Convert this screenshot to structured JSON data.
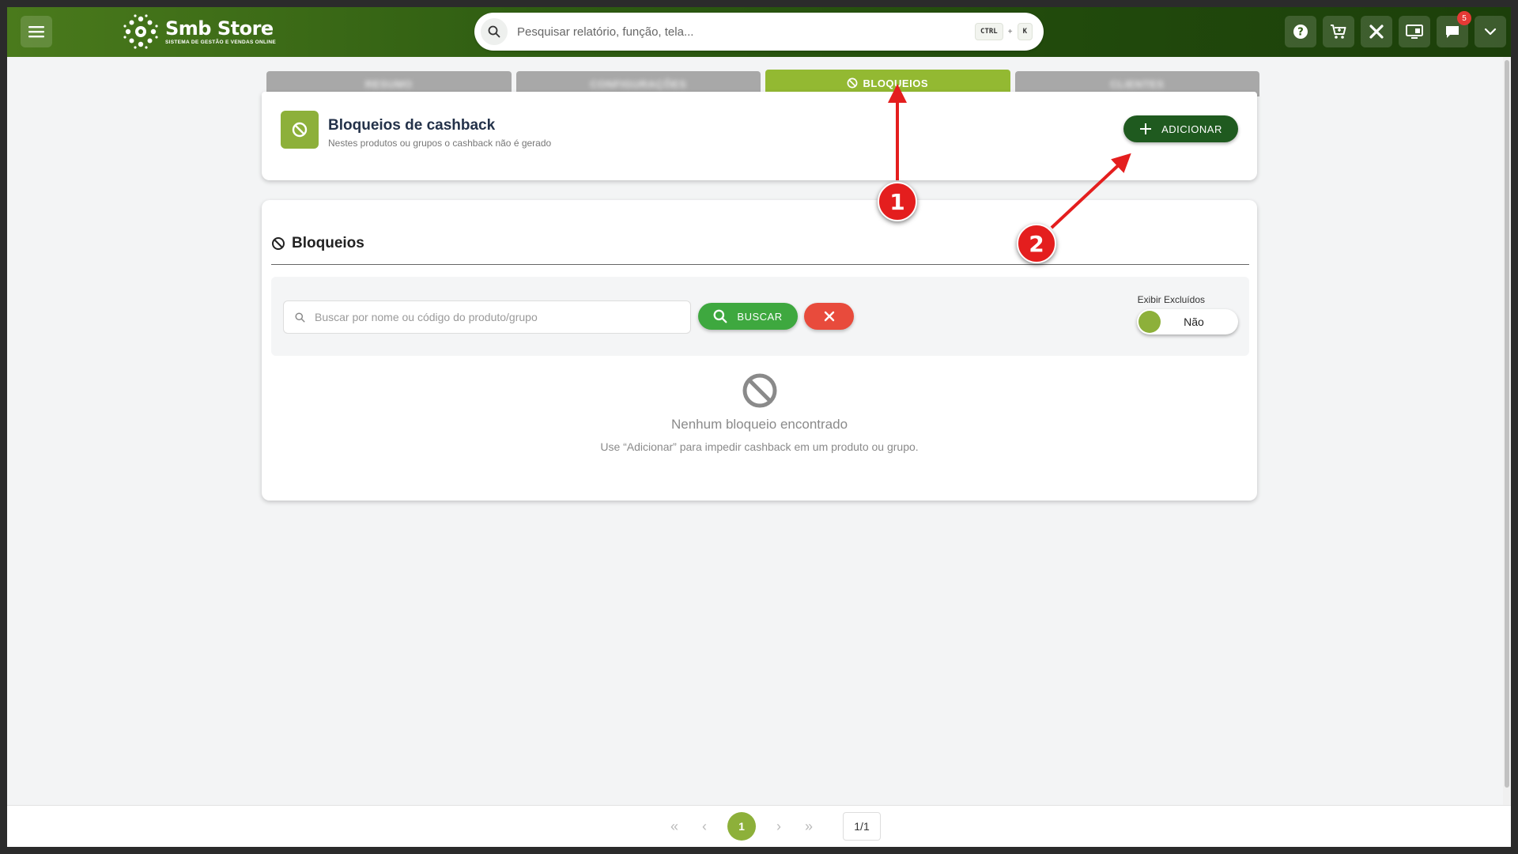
{
  "header": {
    "brand_title": "Smb Store",
    "brand_subtitle": "SISTEMA DE GESTÃO E VENDAS ONLINE",
    "search_placeholder": "Pesquisar relatório, função, tela...",
    "shortcut_ctrl": "CTRL",
    "shortcut_plus": "+",
    "shortcut_key": "K",
    "icons": [
      "help-icon",
      "cart-icon",
      "tools-icon",
      "screen-icon",
      "chat-icon",
      "chevron-down-icon"
    ],
    "notification_count": "5"
  },
  "tabs": [
    {
      "label": "RESUMO",
      "blurred": true
    },
    {
      "label": "CONFIGURAÇÕES",
      "blurred": true
    },
    {
      "label": "BLOQUEIOS",
      "active": true
    },
    {
      "label": "CLIENTES",
      "blurred": true
    }
  ],
  "top_card": {
    "title": "Bloqueios de cashback",
    "subtitle": "Nestes produtos ou grupos o cashback não é gerado",
    "add_label": "ADICIONAR"
  },
  "list_card": {
    "title": "Bloqueios",
    "search_placeholder": "Buscar por nome ou código do produto/grupo",
    "search_label": "BUSCAR",
    "toggle_label": "Exibir Excluídos",
    "toggle_value": "Não",
    "empty_title": "Nenhum bloqueio encontrado",
    "empty_subtitle": "Use “Adicionar” para impedir cashback em um produto ou grupo."
  },
  "pagination": {
    "current": "1",
    "total": "1/1"
  },
  "annotations": [
    {
      "number": "1"
    },
    {
      "number": "2"
    }
  ],
  "colors": {
    "accent_green": "#93b932",
    "dark_green": "#1f5a1f",
    "header_green": "#2f5d12",
    "danger": "#e84b3c",
    "marker_red": "#e41e1e"
  }
}
